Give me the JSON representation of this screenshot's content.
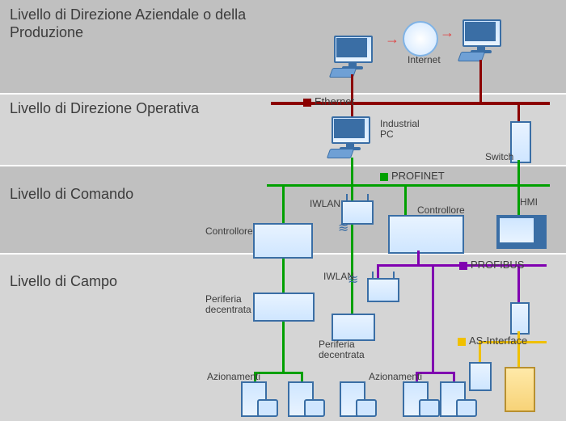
{
  "layers": {
    "l0": "Livello di Direzione Aziendale o della Produzione",
    "l1": "Livello di Direzione Operativa",
    "l2": "Livello di Comando",
    "l3": "Livello di Campo"
  },
  "networks": {
    "ethernet": "Ethernet",
    "profinet": "PROFINET",
    "profibus": "PROFIBUS",
    "asi": "AS-Interface"
  },
  "devices": {
    "internet": "Internet",
    "industrial_pc": "Industrial\nPC",
    "switch": "Switch",
    "iwlan1": "IWLAN",
    "iwlan2": "IWLAN",
    "controller1": "Controllore",
    "controller2": "Controllore",
    "hmi": "HMI",
    "periferia1": "Periferia\ndecentrata",
    "periferia2": "Periferia\ndecentrata",
    "azionamenti1": "Azionamenti",
    "azionamenti2": "Azionamenti"
  }
}
